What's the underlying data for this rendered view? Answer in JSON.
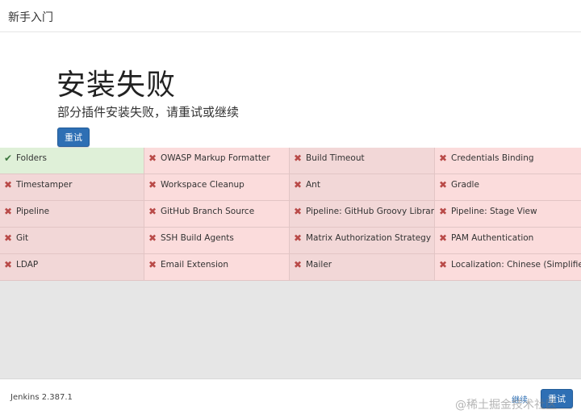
{
  "header": {
    "title": "新手入门"
  },
  "hero": {
    "heading": "安装失败",
    "subtitle": "部分插件安装失败，请重试或继续",
    "retry_label": "重试"
  },
  "plugins": [
    {
      "name": "Folders",
      "status": "success",
      "icon": "check-icon"
    },
    {
      "name": "OWASP Markup Formatter",
      "status": "failed",
      "icon": "cross-icon"
    },
    {
      "name": "Build Timeout",
      "status": "failed",
      "icon": "cross-icon"
    },
    {
      "name": "Credentials Binding",
      "status": "failed",
      "icon": "cross-icon"
    },
    {
      "name": "Timestamper",
      "status": "failed",
      "icon": "cross-icon"
    },
    {
      "name": "Workspace Cleanup",
      "status": "failed",
      "icon": "cross-icon"
    },
    {
      "name": "Ant",
      "status": "failed",
      "icon": "cross-icon"
    },
    {
      "name": "Gradle",
      "status": "failed",
      "icon": "cross-icon"
    },
    {
      "name": "Pipeline",
      "status": "failed",
      "icon": "cross-icon"
    },
    {
      "name": "GitHub Branch Source",
      "status": "failed",
      "icon": "cross-icon"
    },
    {
      "name": "Pipeline: GitHub Groovy Libraries",
      "status": "failed",
      "icon": "cross-icon"
    },
    {
      "name": "Pipeline: Stage View",
      "status": "failed",
      "icon": "cross-icon"
    },
    {
      "name": "Git",
      "status": "failed",
      "icon": "cross-icon"
    },
    {
      "name": "SSH Build Agents",
      "status": "failed",
      "icon": "cross-icon"
    },
    {
      "name": "Matrix Authorization Strategy",
      "status": "failed",
      "icon": "cross-icon"
    },
    {
      "name": "PAM Authentication",
      "status": "failed",
      "icon": "cross-icon"
    },
    {
      "name": "LDAP",
      "status": "failed",
      "icon": "cross-icon"
    },
    {
      "name": "Email Extension",
      "status": "failed",
      "icon": "cross-icon"
    },
    {
      "name": "Mailer",
      "status": "failed",
      "icon": "cross-icon"
    },
    {
      "name": "Localization: Chinese (Simplified)",
      "status": "failed",
      "icon": "cross-icon"
    }
  ],
  "footer": {
    "version": "Jenkins 2.387.1",
    "continue_label": "继续",
    "retry_label": "重试",
    "watermark": "@稀土掘金技术社区"
  },
  "colors": {
    "primary": "#2e6fb4",
    "success_bg": "#dff0d8",
    "fail_bg": "#f2dede",
    "fail_icon": "#b94a48",
    "success_icon": "#3c763d"
  }
}
